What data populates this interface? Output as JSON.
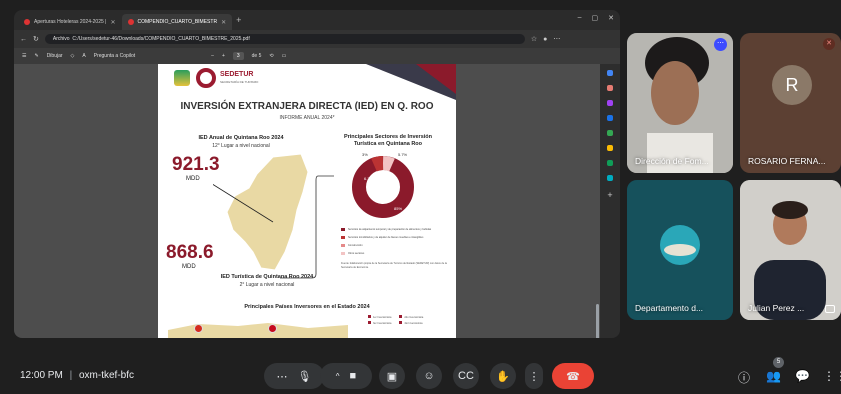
{
  "browser": {
    "tabs": [
      {
        "label": "Aperturas Hoteleras 2024-2025 | "
      },
      {
        "label": "COMPENDIO_CUARTO_BIMESTR"
      }
    ],
    "address": {
      "prefix": "Archivo",
      "url": "C:/Users/sedetur-46/Downloads/COMPENDIO_CUARTO_BIMESTRE_2025.pdf"
    },
    "pdf_toolbar": {
      "draw_label": "Dibujar",
      "copilot_label": "Pregunta a Copilot",
      "page_current": "3",
      "page_total": "de 5"
    }
  },
  "document": {
    "logo_text": "SEDETUR",
    "logo_sub": "SECRETARÍA DE TURISMO",
    "title": "INVERSIÓN EXTRANJERA DIRECTA (IED) EN Q. ROO",
    "subtitle": "INFORME ANUAL 2024*",
    "ied_title": "IED Anual de Quintana Roo 2024",
    "ied_rank": "12° Lugar a nivel nacional",
    "ied_value_1": "921.3",
    "ied_unit_1": "MDD",
    "ied_value_2": "868.6",
    "ied_unit_2": "MDD",
    "tur_title": "IED Turística de Quintana Roo 2024",
    "tur_rank": "2° Lugar a nivel nacional",
    "sectors_title": "Principales Sectores de Inversión Turística en Quintana Roo",
    "pct_small_1": "3%",
    "pct_small_2": "5.7%",
    "pct_mid": "6.3%",
    "pct_big": "85%",
    "legend": [
      "Servicios de alojamiento temporal y de preparación de alimentos y bebidas",
      "Servicios inmobiliarios y de alquiler de bienes muebles e intangibles",
      "Construcción",
      "Otros sectores"
    ],
    "source": "Fuente: Elaboración propia de la Secretaría de Turismo del Estado (SEDETUR) con datos de la Secretaría de Economía.",
    "countries_title": "Principales Países Inversores en el Estado 2024",
    "countries_legend": [
      "1er Inversionista",
      "2do Inversionista",
      "3er Inversionista",
      "4to Inversionista"
    ]
  },
  "participants": [
    {
      "name": "Dirección de Fom..."
    },
    {
      "name": "ROSARIO FERNA...",
      "initial": "R"
    },
    {
      "name": "Departamento d..."
    },
    {
      "name": "Julian Perez ..."
    }
  ],
  "meeting": {
    "time": "12:00 PM",
    "separator": "|",
    "code": "oxm-tkef-bfc",
    "people_count": "5"
  },
  "colors": {
    "accent": "#8b1a2b",
    "end_call": "#ea4335"
  }
}
